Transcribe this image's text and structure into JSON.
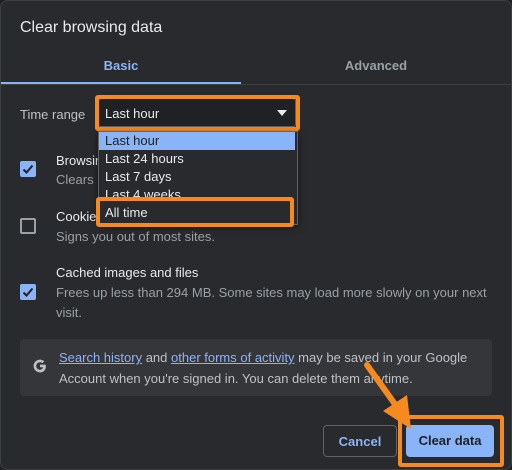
{
  "dialog": {
    "title": "Clear browsing data"
  },
  "tabs": [
    {
      "label": "Basic",
      "active": true
    },
    {
      "label": "Advanced",
      "active": false
    }
  ],
  "time_range": {
    "label": "Time range",
    "selected": "Last hour",
    "options": [
      "Last hour",
      "Last 24 hours",
      "Last 7 days",
      "Last 4 weeks",
      "All time"
    ],
    "highlighted_option": "All time"
  },
  "options": [
    {
      "title": "Browsing",
      "desc": "Clears h",
      "checked": true
    },
    {
      "title": "Cookie",
      "desc": "Signs you out of most sites.",
      "checked": false
    },
    {
      "title": "Cached images and files",
      "desc": "Frees up less than 294 MB. Some sites may load more slowly on your next visit.",
      "checked": true
    }
  ],
  "info": {
    "link1": "Search history",
    "and": " and ",
    "link2": "other forms of activity",
    "rest": " may be saved in your Google Account when you're signed in. You can delete them anytime.",
    "icon": "google-g-icon"
  },
  "buttons": {
    "cancel": "Cancel",
    "clear": "Clear data"
  },
  "colors": {
    "accent": "#8ab4f8",
    "annotation": "#f58a1f",
    "background": "#292a2d"
  }
}
